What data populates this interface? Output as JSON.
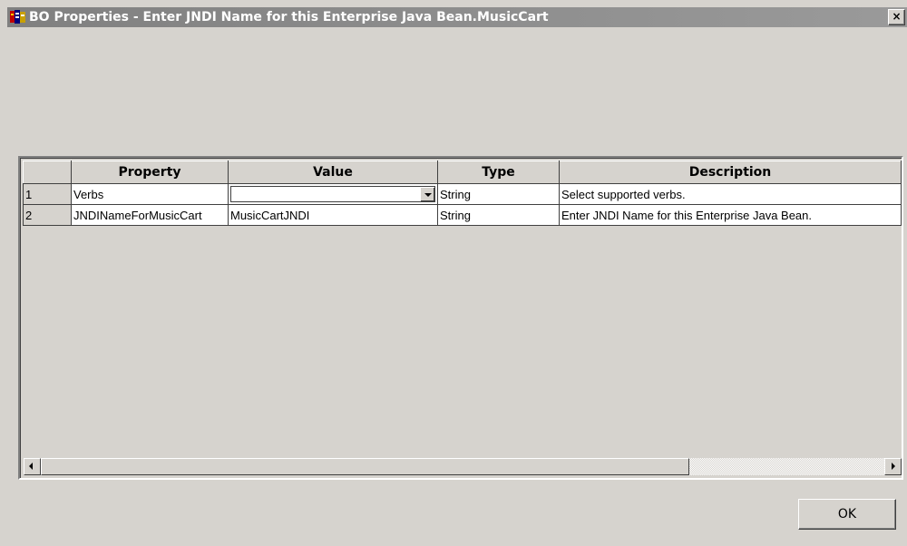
{
  "window": {
    "title": "BO Properties - Enter JNDI Name for this Enterprise Java Bean.MusicCart",
    "close_label": "×"
  },
  "grid": {
    "columns": [
      "",
      "Property",
      "Value",
      "Type",
      "Description"
    ],
    "rows": [
      {
        "num": "1",
        "property": "Verbs",
        "value": "",
        "type": "String",
        "description": "Select supported verbs."
      },
      {
        "num": "2",
        "property": "JNDINameForMusicCart",
        "value": "MusicCartJNDI",
        "type": "String",
        "description": "Enter JNDI Name for this Enterprise Java Bean."
      }
    ]
  },
  "buttons": {
    "ok": "OK"
  },
  "icons": {
    "app": "app-window-icon",
    "dropdown": "chevron-down-icon",
    "scroll_left": "arrow-left-icon",
    "scroll_right": "arrow-right-icon"
  }
}
